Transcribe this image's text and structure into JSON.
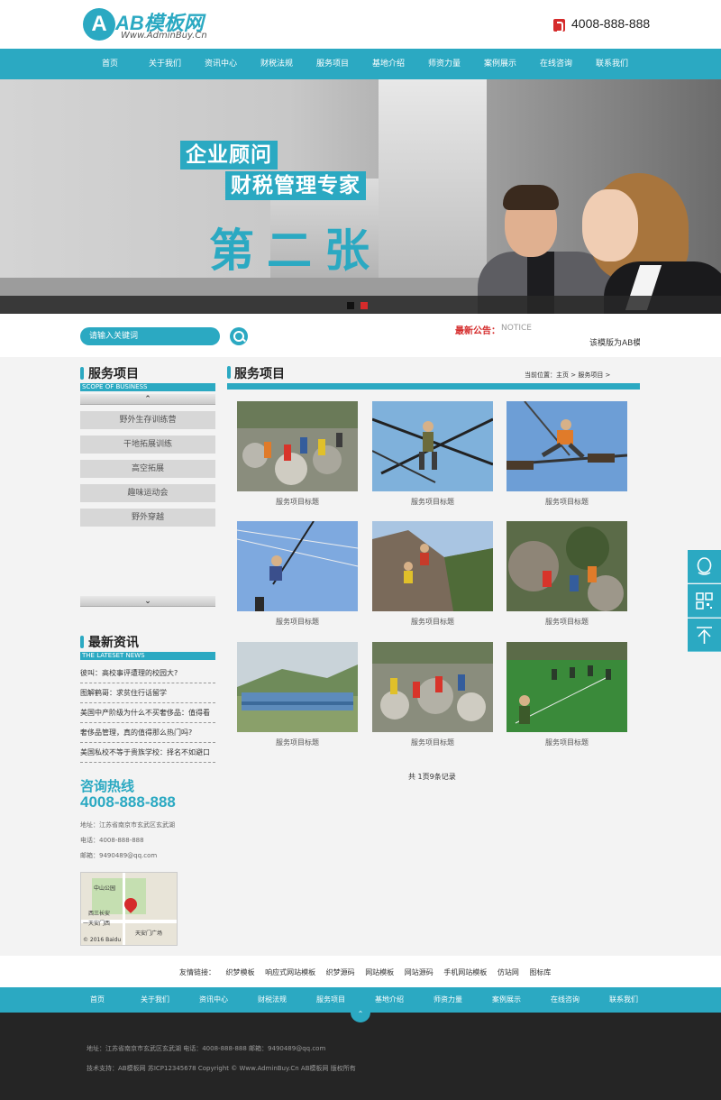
{
  "header": {
    "logo_name": "AB模板网",
    "logo_sub": "Www.AdminBuy.Cn",
    "hotline": "4008-888-888"
  },
  "nav": [
    "首页",
    "关于我们",
    "资讯中心",
    "财税法规",
    "服务项目",
    "基地介绍",
    "师资力量",
    "案例展示",
    "在线咨询",
    "联系我们"
  ],
  "banner": {
    "line1": "企业顾问",
    "line2": "财税管理专家",
    "line3": "第二张"
  },
  "search": {
    "placeholder": "请输入关键词"
  },
  "notice": {
    "label": "最新公告：",
    "en": "NOTICE",
    "text": "该模版为AB模板网"
  },
  "sidebar": {
    "services_title": "服务项目",
    "services_en": "SCOPE OF BUSINESS",
    "categories": [
      "野外生存训练营",
      "干地拓展训练",
      "高空拓展",
      "趣味运动会",
      "野外穿越"
    ],
    "news_title": "最新资讯",
    "news_en": "THE LATESET NEWS",
    "news": [
      "彼叫：高校事评遭理的校园大?",
      "图解鹤哥：求贫住行话留学",
      "美国中产阶级为什么不买奢侈品：值得看",
      "奢侈品管理，真的值得那么热门吗?",
      "美国私校不等于贵族学校：择名不如避口"
    ],
    "contact_title": "咨询热线",
    "contact_phone": "4008-888-888",
    "address": "地址：江苏省南京市玄武区玄武湖",
    "tel": "电话：4008-888-888",
    "email": "邮箱：9490489@qq.com",
    "map_labels": [
      "中山公园",
      "西三长安",
      "一天安门西",
      "天安门广场",
      "© 2016 Baidu"
    ]
  },
  "main": {
    "title": "服务项目",
    "breadcrumb": "当前位置：主页 > 服务项目 >",
    "cards": [
      "服务项目标题",
      "服务项目标题",
      "服务项目标题",
      "服务项目标题",
      "服务项目标题",
      "服务项目标题",
      "服务项目标题",
      "服务项目标题",
      "服务项目标题"
    ],
    "pager": "共 1页9条记录"
  },
  "footer": {
    "links_label": "友情链接：",
    "links": [
      "织梦模板",
      "响应式网站模板",
      "织梦源码",
      "网站模板",
      "网站源码",
      "手机网站模板",
      "仿站网",
      "图标库"
    ],
    "nav": [
      "首页",
      "关于我们",
      "资讯中心",
      "财税法规",
      "服务项目",
      "基地介绍",
      "师资力量",
      "案例展示",
      "在线咨询",
      "联系我们"
    ],
    "address_line": "地址：江苏省南京市玄武区玄武湖    电话：4008-888-888    邮箱：9490489@qq.com",
    "copyright_line": "技术支持：AB模板网    苏ICP12345678    Copyright © Www.AdminBuy.Cn AB模板网 版权所有"
  },
  "colors": {
    "accent": "#2ba9c2",
    "notice_red": "#d52b2b",
    "footer_bg": "#252525"
  },
  "icons": [
    "phone-icon",
    "search-icon",
    "chevron-up-icon",
    "chevron-down-icon",
    "qq-icon",
    "qrcode-icon",
    "back-to-top-icon"
  ]
}
